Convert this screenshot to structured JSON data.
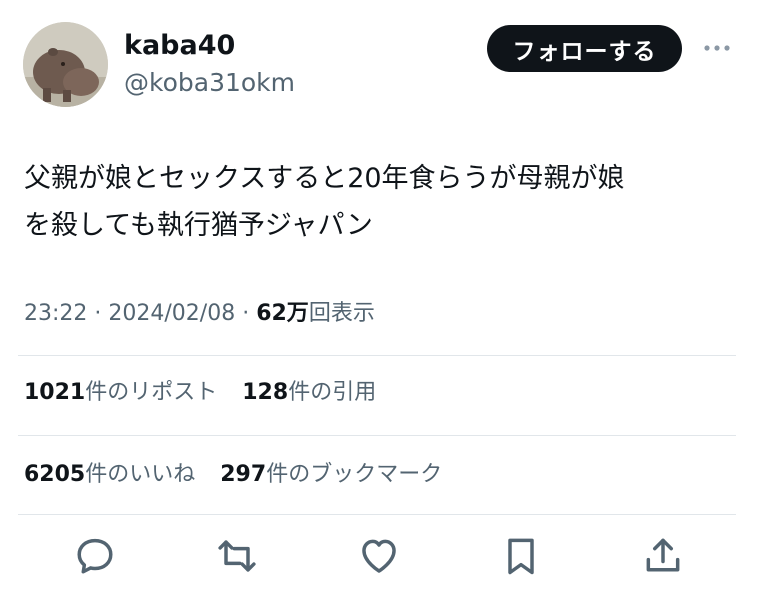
{
  "user": {
    "display_name": "kaba40",
    "handle": "@koba31okm",
    "follow_label": "フォローする"
  },
  "tweet": {
    "text_line1": "父親が娘とセックスすると20年食らうが母親が娘",
    "text_line2": "を殺しても執行猶予ジャパン",
    "time": "23:22",
    "sep1": " · ",
    "date": "2024/02/08",
    "sep2": " · ",
    "views_count": "62万",
    "views_label": "回表示"
  },
  "stats": {
    "reposts_count": "1021",
    "reposts_label": "件のリポスト",
    "quotes_count": "128",
    "quotes_label": "件の引用",
    "likes_count": "6205",
    "likes_label": "件のいいね",
    "bookmarks_count": "297",
    "bookmarks_label": "件のブックマーク"
  },
  "icons": {
    "avatar": "hippo-avatar",
    "more": "more-icon",
    "actions": [
      "reply-icon",
      "repost-icon",
      "like-icon",
      "bookmark-icon",
      "share-icon"
    ]
  },
  "colors": {
    "text": "#0f1419",
    "secondary": "#536471",
    "button_bg": "#0f1419",
    "divider": "#e1e6ea"
  }
}
